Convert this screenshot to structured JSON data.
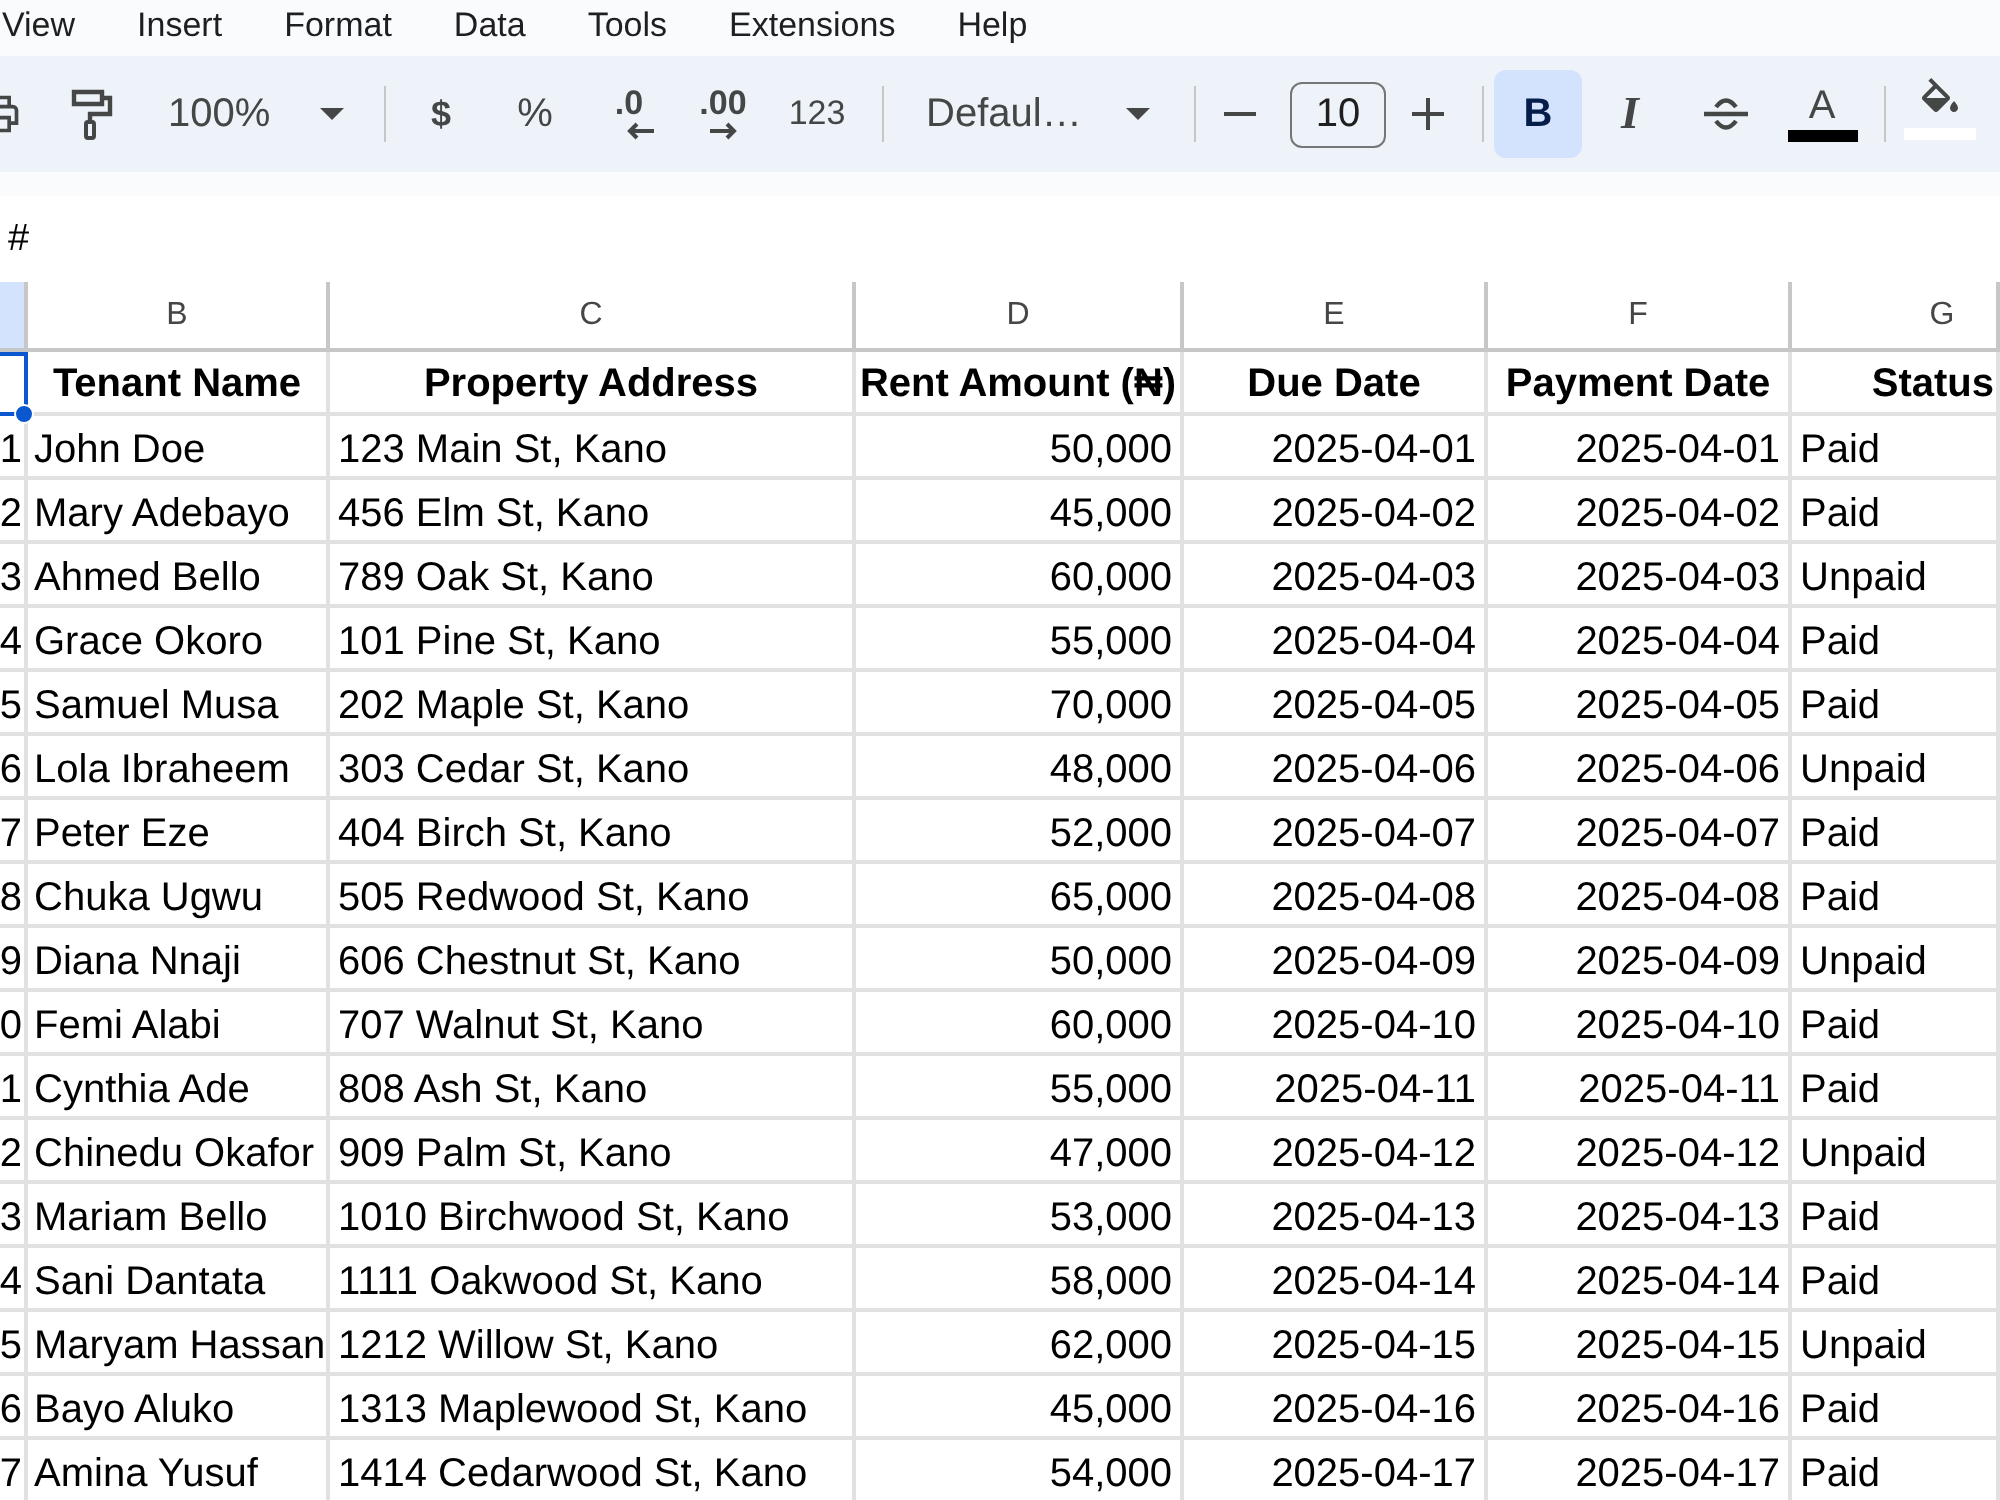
{
  "menu_bar": {
    "items": [
      "View",
      "Insert",
      "Format",
      "Data",
      "Tools",
      "Extensions",
      "Help"
    ]
  },
  "toolbar": {
    "zoom": "100%",
    "currency": "$",
    "percent": "%",
    "decrease_decimals": ".0",
    "increase_decimals": ".00",
    "more_formats": "123",
    "font": "Defaul…",
    "font_size": "10",
    "bold": {
      "label": "B",
      "active": true
    },
    "italic": {
      "label": "I",
      "active": false
    },
    "strikethrough": {
      "active": false
    },
    "text_color": {
      "label": "A"
    }
  },
  "formula_bar": {
    "value": "#"
  },
  "grid": {
    "column_headers": [
      {
        "selected": true
      },
      {
        "label": "B",
        "selected": false
      },
      {
        "label": "C",
        "selected": false
      },
      {
        "label": "D",
        "selected": false
      },
      {
        "label": "E",
        "selected": false
      },
      {
        "label": "F",
        "selected": false
      },
      {
        "label": "G",
        "selected": false
      }
    ],
    "header_row": [
      {
        "selected": true
      },
      {
        "text": "Tenant Name",
        "selected": false
      },
      {
        "text": "Property Address",
        "selected": false
      },
      {
        "text": "Rent Amount (₦)",
        "selected": false
      },
      {
        "text": "Due Date",
        "selected": false
      },
      {
        "text": "Payment Date",
        "selected": false
      },
      {
        "text": "Status",
        "selected": false
      }
    ],
    "rows": [
      [
        "1",
        "John Doe",
        "123 Main St, Kano",
        "50,000",
        "2025-04-01",
        "2025-04-01",
        "Paid"
      ],
      [
        "2",
        "Mary Adebayo",
        "456 Elm St, Kano",
        "45,000",
        "2025-04-02",
        "2025-04-02",
        "Paid"
      ],
      [
        "3",
        "Ahmed Bello",
        "789 Oak St, Kano",
        "60,000",
        "2025-04-03",
        "2025-04-03",
        "Unpaid"
      ],
      [
        "4",
        "Grace Okoro",
        "101 Pine St, Kano",
        "55,000",
        "2025-04-04",
        "2025-04-04",
        "Paid"
      ],
      [
        "5",
        "Samuel Musa",
        "202 Maple St, Kano",
        "70,000",
        "2025-04-05",
        "2025-04-05",
        "Paid"
      ],
      [
        "6",
        "Lola Ibraheem",
        "303 Cedar St, Kano",
        "48,000",
        "2025-04-06",
        "2025-04-06",
        "Unpaid"
      ],
      [
        "7",
        "Peter Eze",
        "404 Birch St, Kano",
        "52,000",
        "2025-04-07",
        "2025-04-07",
        "Paid"
      ],
      [
        "8",
        "Chuka Ugwu",
        "505 Redwood St, Kano",
        "65,000",
        "2025-04-08",
        "2025-04-08",
        "Paid"
      ],
      [
        "9",
        "Diana Nnaji",
        "606 Chestnut St, Kano",
        "50,000",
        "2025-04-09",
        "2025-04-09",
        "Unpaid"
      ],
      [
        "0",
        "Femi Alabi",
        "707 Walnut St, Kano",
        "60,000",
        "2025-04-10",
        "2025-04-10",
        "Paid"
      ],
      [
        "1",
        "Cynthia Ade",
        "808 Ash St, Kano",
        "55,000",
        "2025-04-11",
        "2025-04-11",
        "Paid"
      ],
      [
        "2",
        "Chinedu Okafor",
        "909 Palm St, Kano",
        "47,000",
        "2025-04-12",
        "2025-04-12",
        "Unpaid"
      ],
      [
        "3",
        "Mariam Bello",
        "1010 Birchwood St, Kano",
        "53,000",
        "2025-04-13",
        "2025-04-13",
        "Paid"
      ],
      [
        "4",
        "Sani Dantata",
        "1111 Oakwood St, Kano",
        "58,000",
        "2025-04-14",
        "2025-04-14",
        "Paid"
      ],
      [
        "5",
        "Maryam Hassan",
        "1212 Willow St, Kano",
        "62,000",
        "2025-04-15",
        "2025-04-15",
        "Unpaid"
      ],
      [
        "6",
        "Bayo Aluko",
        "1313 Maplewood St, Kano",
        "45,000",
        "2025-04-16",
        "2025-04-16",
        "Paid"
      ],
      [
        "7",
        "Amina Yusuf",
        "1414 Cedarwood St, Kano",
        "54,000",
        "2025-04-17",
        "2025-04-17",
        "Paid"
      ]
    ]
  }
}
